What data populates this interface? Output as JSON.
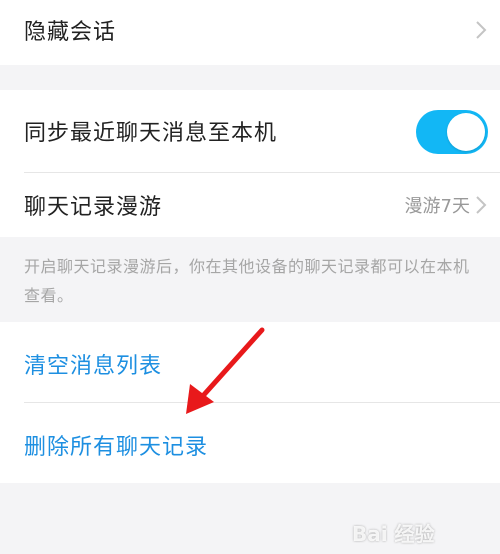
{
  "settings": {
    "hide_chat": {
      "label": "隐藏会话"
    },
    "sync_recent": {
      "label": "同步最近聊天消息至本机",
      "enabled": true
    },
    "roaming": {
      "label": "聊天记录漫游",
      "value": "漫游7天"
    },
    "roaming_note": "开启聊天记录漫游后，你在其他设备的聊天记录都可以在本机查看。",
    "clear_list": {
      "label": "清空消息列表"
    },
    "delete_all": {
      "label": "删除所有聊天记录"
    }
  },
  "icons": {
    "chevron": "chevron-right-icon",
    "annotation": "red-arrow-icon"
  },
  "colors": {
    "accent": "#1d8fe1",
    "toggle_on": "#12b7f5",
    "annotation": "#e8191b",
    "background": "#f4f4f6"
  },
  "watermark": {
    "text": "Bai 经验"
  }
}
